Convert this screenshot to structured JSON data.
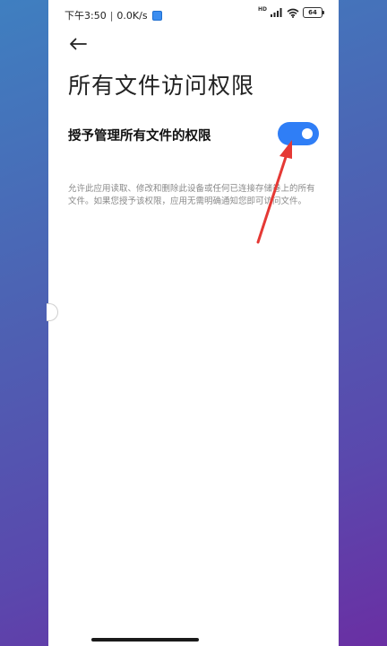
{
  "status_bar": {
    "time": "下午3:50",
    "separator": "|",
    "speed": "0.0K/s",
    "network_label": "HD",
    "battery": "64"
  },
  "header": {
    "title": "所有文件访问权限"
  },
  "setting": {
    "label": "授予管理所有文件的权限",
    "enabled": true
  },
  "description": "允许此应用读取、修改和删除此设备或任何已连接存储卷上的所有文件。如果您授予该权限，应用无需明确通知您即可访问文件。",
  "colors": {
    "toggle_on": "#2f7ef6",
    "annotation_arrow": "#e53935"
  },
  "icons": {
    "back": "back-arrow-icon",
    "signal": "signal-icon",
    "wifi": "wifi-icon",
    "battery": "battery-icon",
    "app_badge": "app-notification-icon"
  }
}
